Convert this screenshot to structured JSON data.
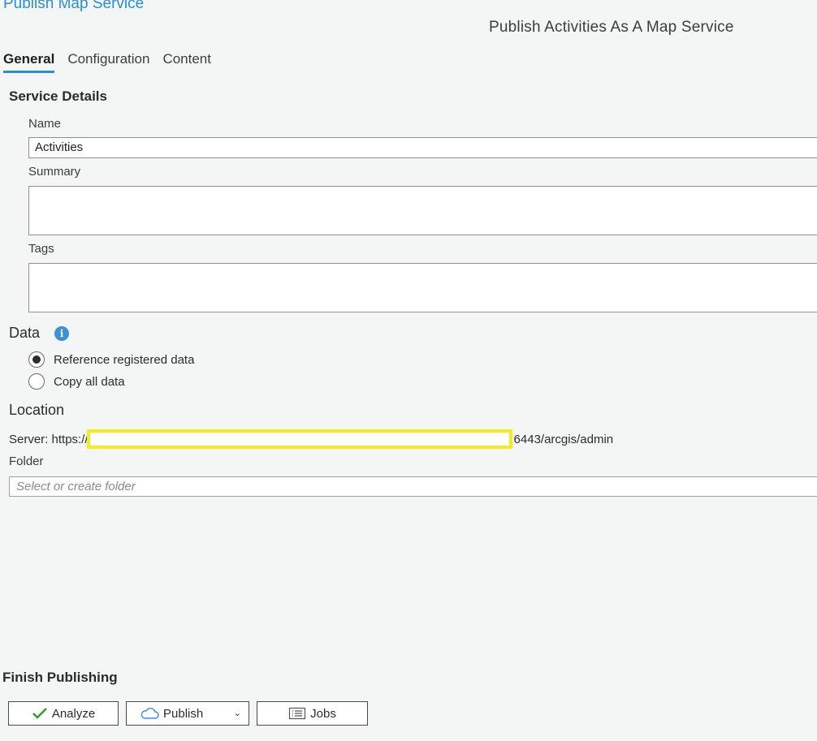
{
  "pane": {
    "title": "Publish Map Service",
    "subtitle": "Publish Activities As A Map Service"
  },
  "tabs": [
    {
      "label": "General",
      "active": true
    },
    {
      "label": "Configuration",
      "active": false
    },
    {
      "label": "Content",
      "active": false
    }
  ],
  "service_details": {
    "heading": "Service Details",
    "name_label": "Name",
    "name_value": "Activities",
    "summary_label": "Summary",
    "summary_value": "",
    "tags_label": "Tags",
    "tags_value": ""
  },
  "data": {
    "heading": "Data",
    "info_icon": "info-icon",
    "options": [
      {
        "label": "Reference registered data",
        "selected": true
      },
      {
        "label": "Copy all data",
        "selected": false
      }
    ]
  },
  "location": {
    "heading": "Location",
    "server_prefix": "Server: https://",
    "server_suffix": "6443/arcgis/admin",
    "folder_label": "Folder",
    "folder_placeholder": "Select or create folder"
  },
  "finish": {
    "heading": "Finish Publishing",
    "analyze_label": "Analyze",
    "publish_label": "Publish",
    "jobs_label": "Jobs"
  },
  "colors": {
    "accent": "#2a8fd0",
    "highlight": "#f6eb1c",
    "check": "#3a9a3a"
  }
}
